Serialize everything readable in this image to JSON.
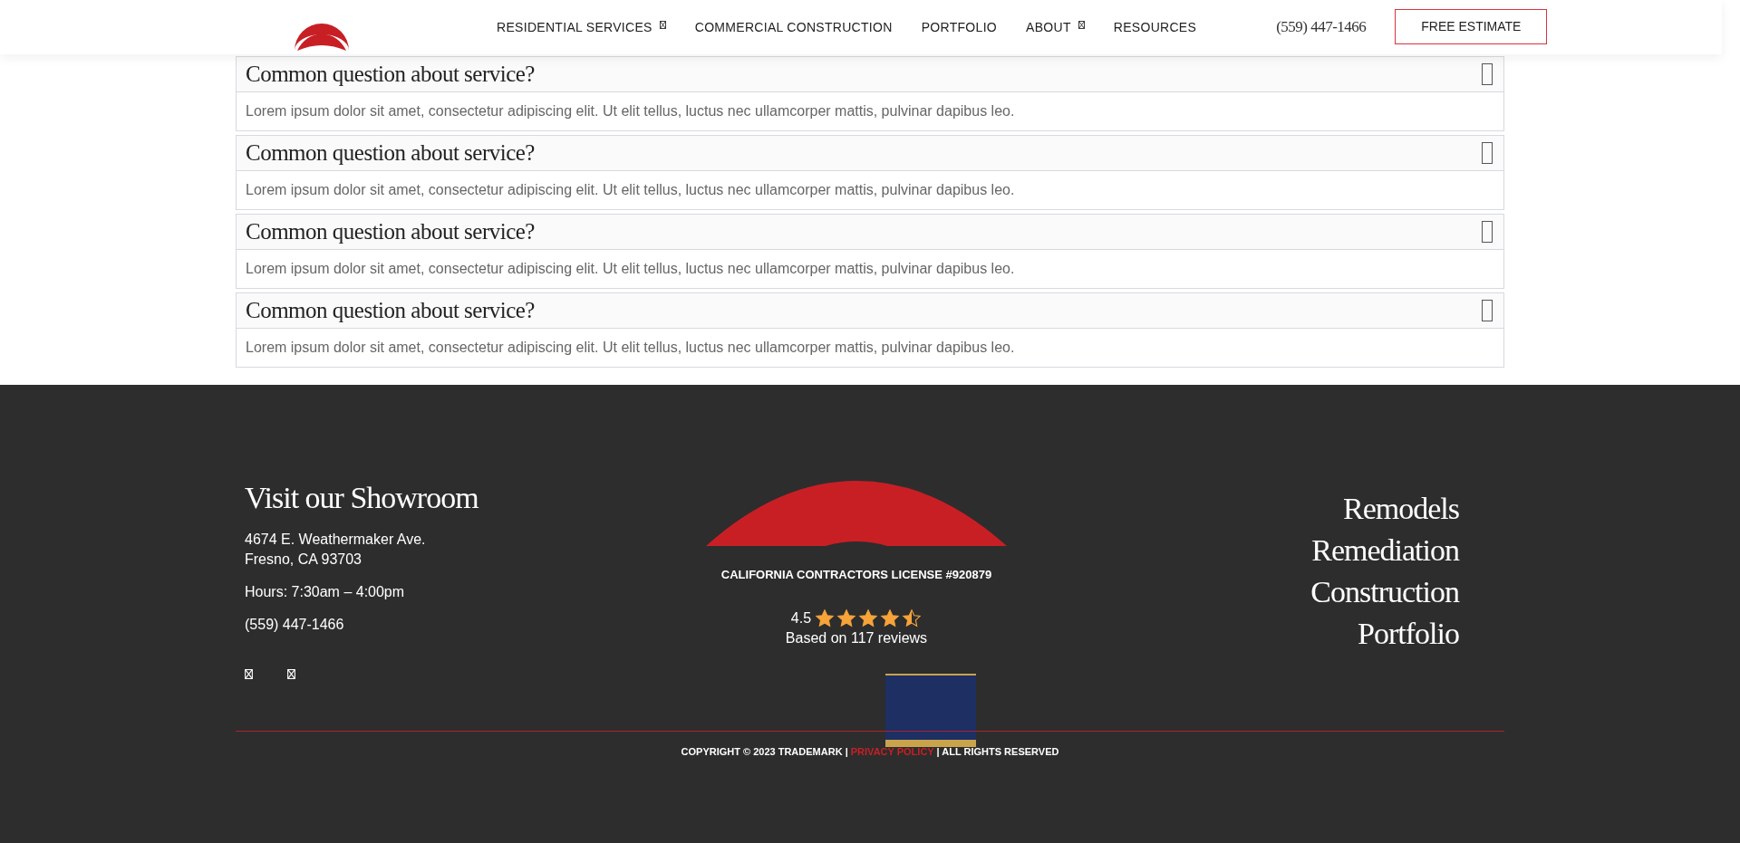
{
  "header": {
    "nav": [
      {
        "label": "RESIDENTIAL SERVICES",
        "dropdown": true
      },
      {
        "label": "COMMERCIAL CONSTRUCTION",
        "dropdown": false
      },
      {
        "label": "PORTFOLIO",
        "dropdown": false
      },
      {
        "label": "ABOUT",
        "dropdown": true
      },
      {
        "label": "RESOURCES",
        "dropdown": false
      }
    ],
    "phone": "(559) 447-1466",
    "cta": "FREE ESTIMATE"
  },
  "faq": [
    {
      "question": "Common question about service?",
      "answer": "Lorem ipsum dolor sit amet, consectetur adipiscing elit. Ut elit tellus, luctus nec ullamcorper mattis, pulvinar dapibus leo."
    },
    {
      "question": "Common question about service?",
      "answer": "Lorem ipsum dolor sit amet, consectetur adipiscing elit. Ut elit tellus, luctus nec ullamcorper mattis, pulvinar dapibus leo."
    },
    {
      "question": "Common question about service?",
      "answer": "Lorem ipsum dolor sit amet, consectetur adipiscing elit. Ut elit tellus, luctus nec ullamcorper mattis, pulvinar dapibus leo."
    },
    {
      "question": "Common question about service?",
      "answer": "Lorem ipsum dolor sit amet, consectetur adipiscing elit. Ut elit tellus, luctus nec ullamcorper mattis, pulvinar dapibus leo."
    }
  ],
  "footer": {
    "showroom": {
      "title": "Visit our Showroom",
      "address": [
        "4674 E. Weathermaker Ave.",
        "Fresno, CA 93703"
      ],
      "hours": "Hours: 7:30am – 4:00pm",
      "phone": "(559) 447-1466"
    },
    "license": "CALIFORNIA CONTRACTORS LICENSE #920879",
    "rating": {
      "score": "4.5",
      "stars": 4.5,
      "reviews": "Based on 117 reviews"
    },
    "links": [
      "Remodels",
      "Remediation",
      "Construction",
      "Portfolio"
    ],
    "copyright": {
      "before": "COPYRIGHT © 2023 TRADEMARK |",
      "link": "PRIVACY POLICY",
      "after": "| ALL RIGHTS RESERVED"
    }
  }
}
